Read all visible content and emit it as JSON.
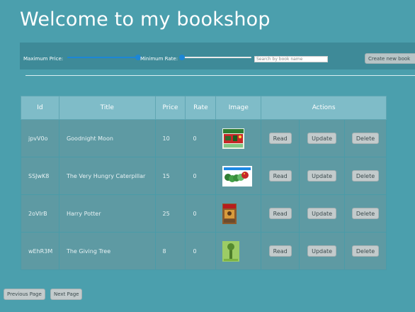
{
  "page": {
    "title": "Welcome to my bookshop"
  },
  "filters": {
    "max_price_label": "Maximum Price:",
    "max_price_level": 1.0,
    "min_rate_label": "Minimum Rate:",
    "min_rate_level": 0.0,
    "search_placeholder": "Search by book name",
    "search_value": "",
    "create_label": "Create new book"
  },
  "table": {
    "headers": [
      "Id",
      "Title",
      "Price",
      "Rate",
      "Image",
      "Actions"
    ],
    "action_labels": {
      "read": "Read",
      "update": "Update",
      "delete": "Delete"
    },
    "rows": [
      {
        "id": "jpvV0o",
        "title": "Goodnight Moon",
        "price": "10",
        "rate": "0",
        "image_icon": "book-cover-goodnight-moon"
      },
      {
        "id": "SSJwK8",
        "title": "The Very Hungry Caterpillar",
        "price": "15",
        "rate": "0",
        "image_icon": "book-cover-hungry-caterpillar"
      },
      {
        "id": "2oVIrB",
        "title": "Harry Potter",
        "price": "25",
        "rate": "0",
        "image_icon": "book-cover-harry-potter"
      },
      {
        "id": "wEhR3M",
        "title": "The Giving Tree",
        "price": "8",
        "rate": "0",
        "image_icon": "book-cover-giving-tree"
      }
    ]
  },
  "pagination": {
    "previous_label": "Previous Page",
    "next_label": "Next Page"
  },
  "colors": {
    "background": "#4b9fad",
    "slider_accent": "#1c86d6"
  }
}
